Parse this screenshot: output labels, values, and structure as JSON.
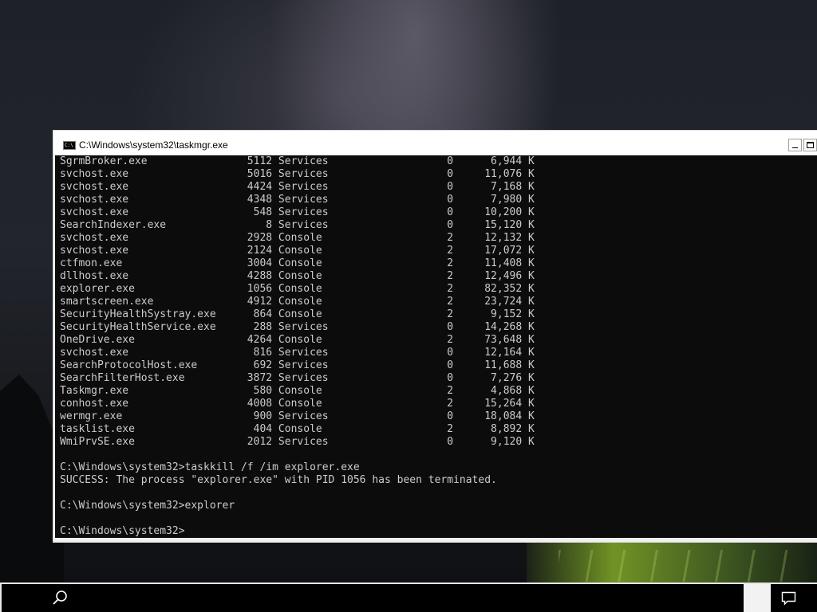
{
  "window": {
    "title": "C:\\Windows\\system32\\taskmgr.exe"
  },
  "console": {
    "processes": [
      {
        "name": "SgrmBroker.exe",
        "pid": "5112",
        "session": "Services",
        "num": "0",
        "mem": "6,944 K"
      },
      {
        "name": "svchost.exe",
        "pid": "5016",
        "session": "Services",
        "num": "0",
        "mem": "11,076 K"
      },
      {
        "name": "svchost.exe",
        "pid": "4424",
        "session": "Services",
        "num": "0",
        "mem": "7,168 K"
      },
      {
        "name": "svchost.exe",
        "pid": "4348",
        "session": "Services",
        "num": "0",
        "mem": "7,980 K"
      },
      {
        "name": "svchost.exe",
        "pid": "548",
        "session": "Services",
        "num": "0",
        "mem": "10,200 K"
      },
      {
        "name": "SearchIndexer.exe",
        "pid": "8",
        "session": "Services",
        "num": "0",
        "mem": "15,120 K"
      },
      {
        "name": "svchost.exe",
        "pid": "2928",
        "session": "Console",
        "num": "2",
        "mem": "12,132 K"
      },
      {
        "name": "svchost.exe",
        "pid": "2124",
        "session": "Console",
        "num": "2",
        "mem": "17,072 K"
      },
      {
        "name": "ctfmon.exe",
        "pid": "3004",
        "session": "Console",
        "num": "2",
        "mem": "11,408 K"
      },
      {
        "name": "dllhost.exe",
        "pid": "4288",
        "session": "Console",
        "num": "2",
        "mem": "12,496 K"
      },
      {
        "name": "explorer.exe",
        "pid": "1056",
        "session": "Console",
        "num": "2",
        "mem": "82,352 K"
      },
      {
        "name": "smartscreen.exe",
        "pid": "4912",
        "session": "Console",
        "num": "2",
        "mem": "23,724 K"
      },
      {
        "name": "SecurityHealthSystray.exe",
        "pid": "864",
        "session": "Console",
        "num": "2",
        "mem": "9,152 K"
      },
      {
        "name": "SecurityHealthService.exe",
        "pid": "288",
        "session": "Services",
        "num": "0",
        "mem": "14,268 K"
      },
      {
        "name": "OneDrive.exe",
        "pid": "4264",
        "session": "Console",
        "num": "2",
        "mem": "73,648 K"
      },
      {
        "name": "svchost.exe",
        "pid": "816",
        "session": "Services",
        "num": "0",
        "mem": "12,164 K"
      },
      {
        "name": "SearchProtocolHost.exe",
        "pid": "692",
        "session": "Services",
        "num": "0",
        "mem": "11,688 K"
      },
      {
        "name": "SearchFilterHost.exe",
        "pid": "3872",
        "session": "Services",
        "num": "0",
        "mem": "7,276 K"
      },
      {
        "name": "Taskmgr.exe",
        "pid": "580",
        "session": "Console",
        "num": "2",
        "mem": "4,868 K"
      },
      {
        "name": "conhost.exe",
        "pid": "4008",
        "session": "Console",
        "num": "2",
        "mem": "15,264 K"
      },
      {
        "name": "wermgr.exe",
        "pid": "900",
        "session": "Services",
        "num": "0",
        "mem": "18,084 K"
      },
      {
        "name": "tasklist.exe",
        "pid": "404",
        "session": "Console",
        "num": "2",
        "mem": "8,892 K"
      },
      {
        "name": "WmiPrvSE.exe",
        "pid": "2012",
        "session": "Services",
        "num": "0",
        "mem": "9,120 K"
      }
    ],
    "lines_after": [
      "",
      "C:\\Windows\\system32>taskkill /f /im explorer.exe",
      "SUCCESS: The process \"explorer.exe\" with PID 1056 has been terminated.",
      "",
      "C:\\Windows\\system32>explorer",
      "",
      "C:\\Windows\\system32>"
    ]
  },
  "taskbar": {
    "search_icon": "search-icon",
    "action_center_icon": "action-center-icon"
  }
}
